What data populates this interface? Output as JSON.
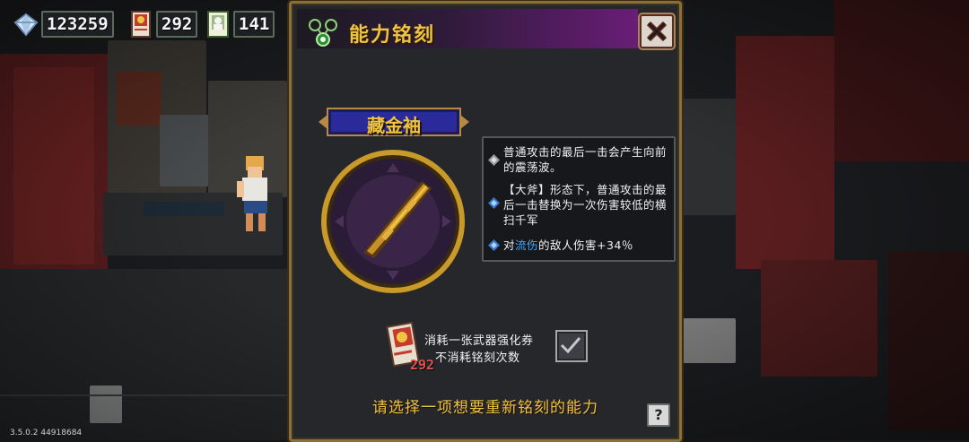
{
  "currencies": [
    {
      "name": "gems",
      "icon": "diamond-icon",
      "value": "123259"
    },
    {
      "name": "weapon-upgrade-coupons",
      "icon": "coupon-icon",
      "value": "292"
    },
    {
      "name": "scrolls",
      "icon": "scroll-icon",
      "value": "141"
    }
  ],
  "version": "3.5.0.2 44918684",
  "dialog": {
    "title": "能力铭刻",
    "weapon_name": "藏金袖",
    "abilities": [
      {
        "text": "普通攻击的最后一击会产生向前的震荡波。"
      },
      {
        "text": "【大斧】形态下，普通攻击的最后一击替换为一次伤害较低的横扫千军"
      },
      {
        "prefix": "对",
        "highlight": "流伤",
        "suffix": "的敌人伤害+34％"
      }
    ],
    "coupon": {
      "line1": "消耗一张武器强化券",
      "line2": "不消耗铭刻次数",
      "count": "292",
      "checked": true
    },
    "prompt": "请选择一项想要重新铭刻的能力",
    "help_label": "?"
  },
  "colors": {
    "gold_text": "#f0c442",
    "highlight_blue": "#3aa6ff",
    "title_purple": "#6a1d77",
    "frame_gold": "#8b6f38"
  }
}
